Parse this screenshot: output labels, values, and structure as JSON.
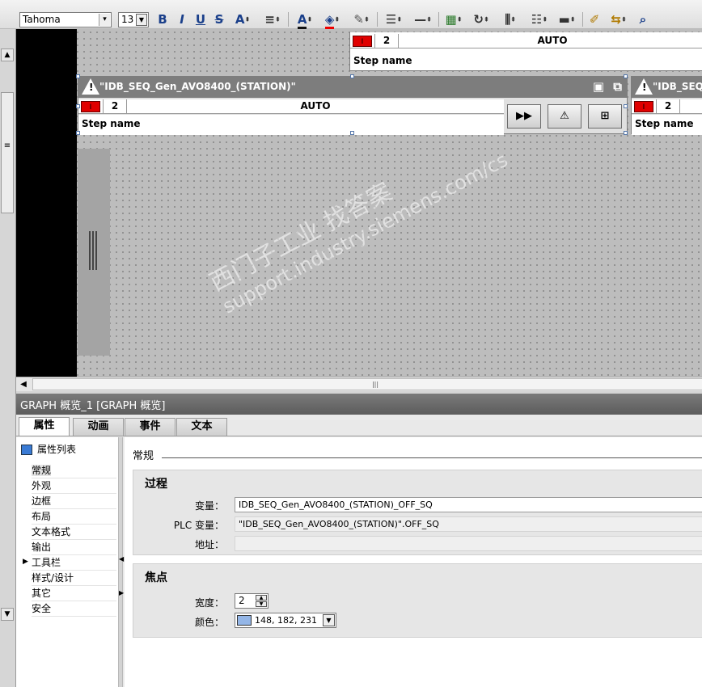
{
  "toolbar": {
    "font": "Tahoma",
    "size": "13",
    "bold": "B",
    "italic": "I",
    "underline": "U",
    "strike": "S",
    "fontsize_up": "A"
  },
  "sequences": [
    {
      "name": "\"IDB_SEQ_Gen_AVO8400_(STATION)\"",
      "step_num": "2",
      "mode": "AUTO",
      "step_label": "Step name"
    },
    {
      "name": "\"IDB_SEQ_",
      "step_num": "2",
      "step_label": "Step name"
    }
  ],
  "top_partial": {
    "step_num": "2",
    "mode": "AUTO",
    "step_label": "Step name"
  },
  "inspector": {
    "title": "GRAPH 概览_1 [GRAPH 概览]",
    "tabs": [
      "属性",
      "动画",
      "事件",
      "文本"
    ],
    "nav_header": "属性列表",
    "nav_items": [
      "常规",
      "外观",
      "边框",
      "布局",
      "文本格式",
      "输出",
      "工具栏",
      "样式/设计",
      "其它",
      "安全"
    ],
    "section_title": "常规",
    "process": {
      "title": "过程",
      "variable_label": "变量：",
      "variable_value": "IDB_SEQ_Gen_AVO8400_(STATION)_OFF_SQ",
      "plc_label": "PLC 变量：",
      "plc_value": "\"IDB_SEQ_Gen_AVO8400_(STATION)\".OFF_SQ",
      "address_label": "地址："
    },
    "focus": {
      "title": "焦点",
      "width_label": "宽度：",
      "width_value": "2",
      "color_label": "颜色：",
      "color_value": "148, 182, 231",
      "color_hex": "#94b6e7"
    }
  },
  "watermark": {
    "line1": "西门子工业   找答案",
    "line2": "support.industry.siemens.com/cs"
  }
}
